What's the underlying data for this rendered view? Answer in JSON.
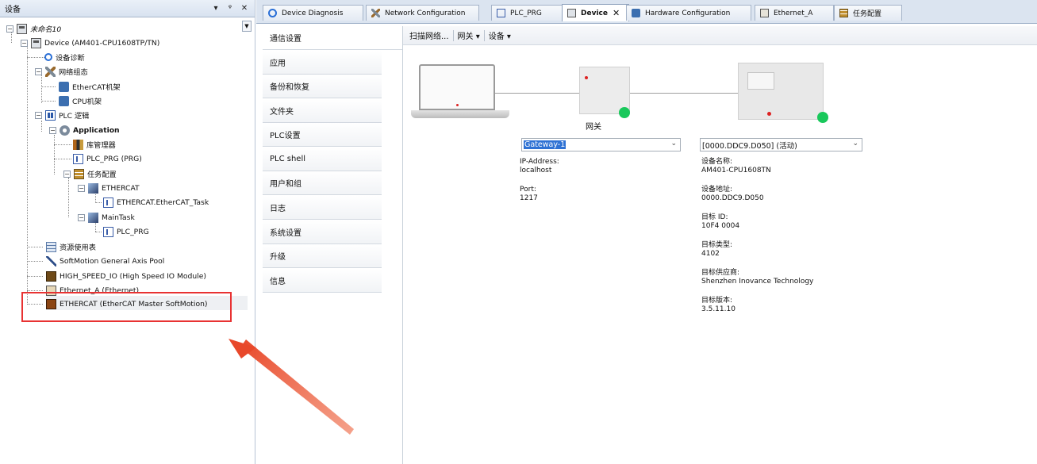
{
  "left_pane": {
    "title": "设备",
    "header_buttons": [
      "▾",
      "ᵠ",
      "✕"
    ],
    "scroll_button": "▼",
    "tree": [
      {
        "label": "未命名10"
      },
      {
        "label": "Device (AM401-CPU1608TP/TN)"
      },
      {
        "label": "设备诊断"
      },
      {
        "label": "网络组态"
      },
      {
        "label": "EtherCAT机架"
      },
      {
        "label": "CPU机架"
      },
      {
        "label": "PLC 逻辑"
      },
      {
        "label": "Application"
      },
      {
        "label": "库管理器"
      },
      {
        "label": "PLC_PRG (PRG)"
      },
      {
        "label": "任务配置"
      },
      {
        "label": "ETHERCAT"
      },
      {
        "label": "ETHERCAT.EtherCAT_Task"
      },
      {
        "label": "MainTask"
      },
      {
        "label": "PLC_PRG"
      },
      {
        "label": "资源使用表"
      },
      {
        "label": "SoftMotion General Axis Pool"
      },
      {
        "label": "HIGH_SPEED_IO (High Speed IO Module)"
      },
      {
        "label": "Ethernet_A (Ethernet)"
      },
      {
        "label": "ETHERCAT (EtherCAT Master SoftMotion)"
      }
    ]
  },
  "tabs": [
    {
      "label": "Device Diagnosis"
    },
    {
      "label": "Network Configuration"
    },
    {
      "label": "PLC_PRG"
    },
    {
      "label": "Device",
      "close": "✕"
    },
    {
      "label": "Hardware Configuration"
    },
    {
      "label": "Ethernet_A"
    },
    {
      "label": "任务配置"
    }
  ],
  "nav": [
    {
      "label": "通信设置"
    },
    {
      "label": "应用"
    },
    {
      "label": "备份和恢复"
    },
    {
      "label": "文件夹"
    },
    {
      "label": "PLC设置"
    },
    {
      "label": "PLC shell"
    },
    {
      "label": "用户和组"
    },
    {
      "label": "日志"
    },
    {
      "label": "系统设置"
    },
    {
      "label": "升级"
    },
    {
      "label": "信息"
    }
  ],
  "toolbar": {
    "scan": "扫描网络...",
    "gateway": "网关 ▾",
    "device": "设备 ▾"
  },
  "gateway": {
    "label": "网关",
    "select_value": "Gateway-1",
    "caret": "⌄",
    "ip_label": "IP-Address:",
    "ip_value": "localhost",
    "port_label": "Port:",
    "port_value": "1217"
  },
  "device": {
    "select_value": "[0000.DDC9.D050] (活动)",
    "caret": "⌄",
    "fields": [
      {
        "k": "设备名称:",
        "v": "AM401-CPU1608TN"
      },
      {
        "k": "设备地址:",
        "v": "0000.DDC9.D050"
      },
      {
        "k": "目标 ID:",
        "v": "10F4  0004"
      },
      {
        "k": "目标类型:",
        "v": "4102"
      },
      {
        "k": "目标供应商:",
        "v": "Shenzhen Inovance Technology"
      },
      {
        "k": "目标版本:",
        "v": "3.5.11.10"
      }
    ]
  },
  "colors": {
    "highlight": "#e83232",
    "status_ok": "#19c85b",
    "selection": "#2f72d4"
  }
}
